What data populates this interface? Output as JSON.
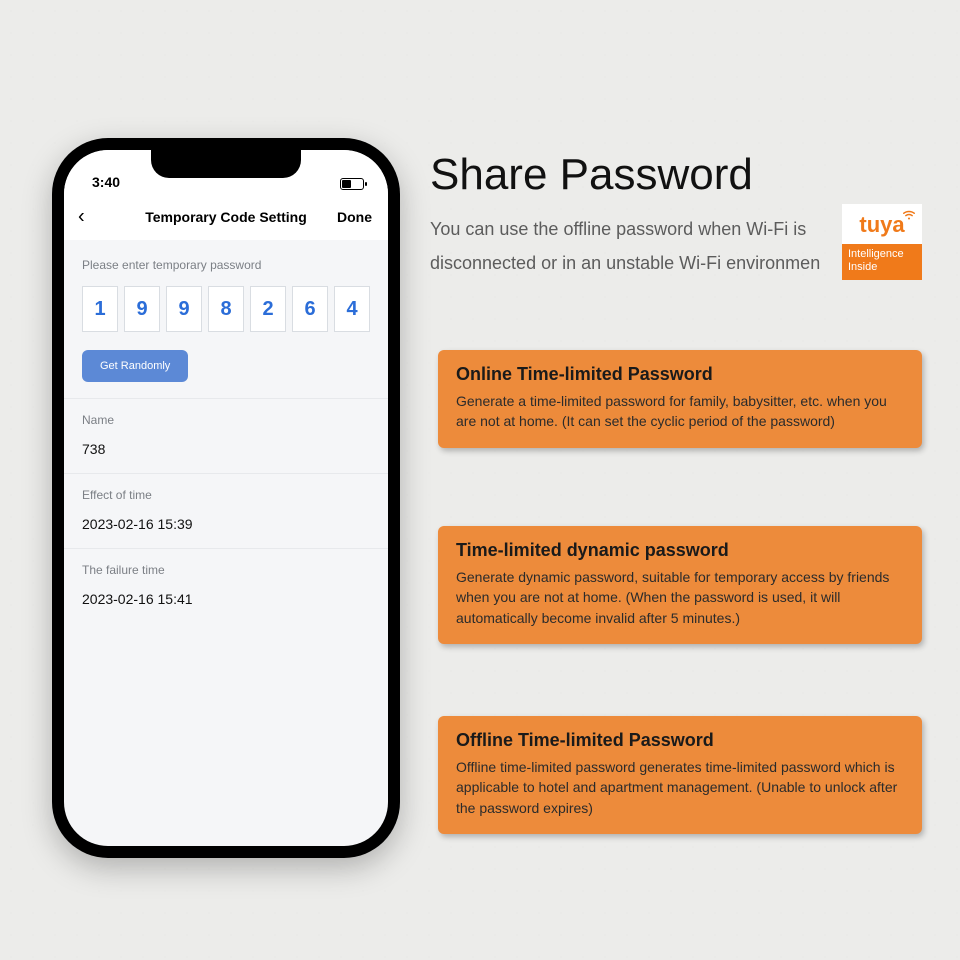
{
  "phone": {
    "time": "3:40",
    "title": "Temporary Code Setting",
    "done": "Done",
    "hint": "Please enter temporary password",
    "otp": [
      "1",
      "9",
      "9",
      "8",
      "2",
      "6",
      "4"
    ],
    "get_randomly": "Get Randomly",
    "rows": [
      {
        "label": "Name",
        "value": "738"
      },
      {
        "label": "Effect of time",
        "value": "2023-02-16 15:39"
      },
      {
        "label": "The failure time",
        "value": "2023-02-16 15:41"
      }
    ]
  },
  "headline": "Share Password",
  "subhead": "You can use the offline password when Wi-Fi is disconnected or in an unstable Wi-Fi environmen",
  "tuya": {
    "brand": "tuya",
    "tag": "Intelligence Inside"
  },
  "cards": [
    {
      "title": "Online Time-limited Password",
      "body": "Generate a time-limited password for family, babysitter, etc. when you are not at home.  (It can set the cyclic period of the password)"
    },
    {
      "title": "Time-limited dynamic password",
      "body": "Generate dynamic password, suitable for temporary access by friends when you are not at home. (When the password is used, it will automatically become invalid after 5 minutes.)"
    },
    {
      "title": "Offline Time-limited Password",
      "body": "Offline time-limited password generates time-limited password which is applicable to hotel and apartment management. (Unable to unlock after the password expires)"
    }
  ]
}
